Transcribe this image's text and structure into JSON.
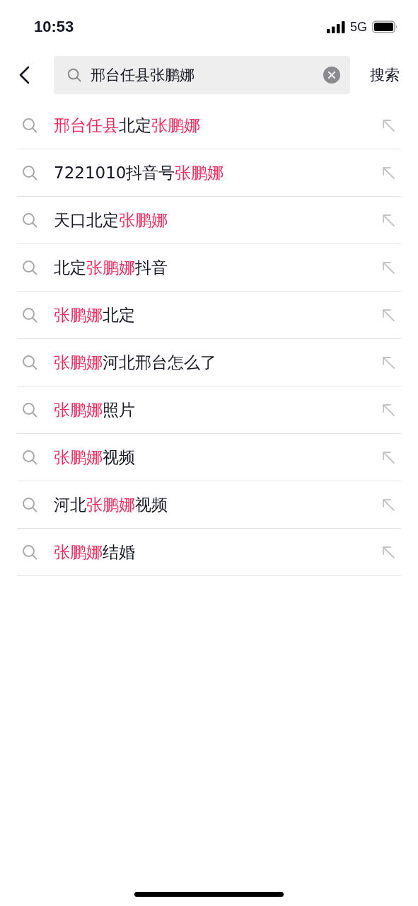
{
  "status_bar": {
    "time": "10:53",
    "network": "5G"
  },
  "search": {
    "value": "邢台任县张鹏娜",
    "action": "搜索"
  },
  "suggestions": [
    {
      "segments": [
        {
          "text": "邢台任县",
          "highlight": true
        },
        {
          "text": "北定",
          "highlight": false
        },
        {
          "text": "张鹏娜",
          "highlight": true
        }
      ]
    },
    {
      "segments": [
        {
          "text": "7221010抖音号",
          "highlight": false
        },
        {
          "text": "张鹏娜",
          "highlight": true
        }
      ]
    },
    {
      "segments": [
        {
          "text": "天口北定",
          "highlight": false
        },
        {
          "text": "张鹏娜",
          "highlight": true
        }
      ]
    },
    {
      "segments": [
        {
          "text": "北定",
          "highlight": false
        },
        {
          "text": "张鹏娜",
          "highlight": true
        },
        {
          "text": "抖音",
          "highlight": false
        }
      ]
    },
    {
      "segments": [
        {
          "text": "张鹏娜",
          "highlight": true
        },
        {
          "text": "北定",
          "highlight": false
        }
      ]
    },
    {
      "segments": [
        {
          "text": "张鹏娜",
          "highlight": true
        },
        {
          "text": "河北邢台怎么了",
          "highlight": false
        }
      ]
    },
    {
      "segments": [
        {
          "text": "张鹏娜",
          "highlight": true
        },
        {
          "text": "照片",
          "highlight": false
        }
      ]
    },
    {
      "segments": [
        {
          "text": "张鹏娜",
          "highlight": true
        },
        {
          "text": "视频",
          "highlight": false
        }
      ]
    },
    {
      "segments": [
        {
          "text": "河北",
          "highlight": false
        },
        {
          "text": "张鹏娜",
          "highlight": true
        },
        {
          "text": "视频",
          "highlight": false
        }
      ]
    },
    {
      "segments": [
        {
          "text": "张鹏娜",
          "highlight": true
        },
        {
          "text": "结婚",
          "highlight": false
        }
      ]
    }
  ]
}
